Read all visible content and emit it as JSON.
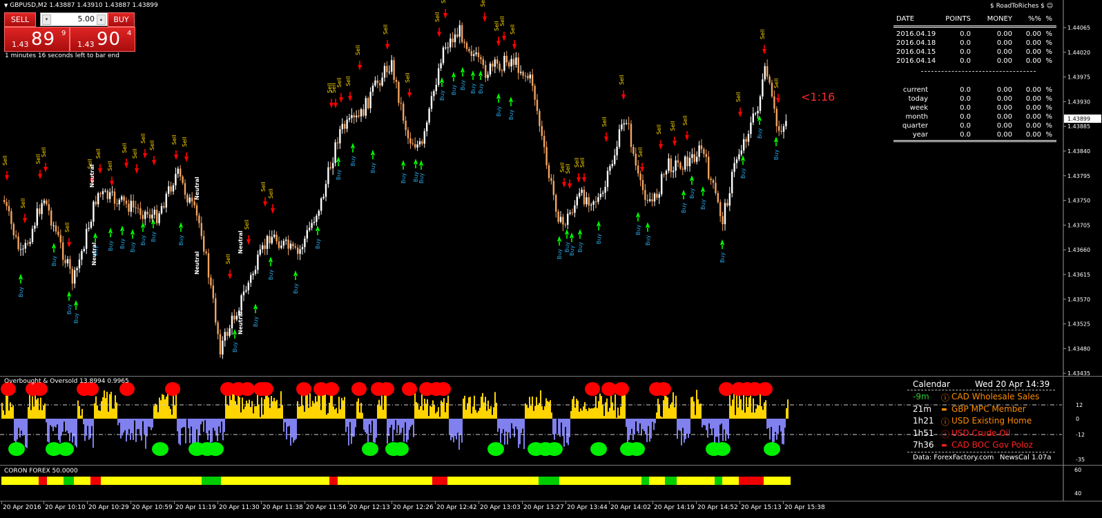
{
  "header": {
    "symbol": "GBPUSD,M2",
    "ohlc": "1.43887 1.43910 1.43887 1.43899",
    "ea_name": "$ RoadToRiches $ ☺",
    "countdown": "1 minutes 16 seconds left to bar end",
    "bar_timer": "<1:16"
  },
  "trade_panel": {
    "sell_label": "SELL",
    "buy_label": "BUY",
    "lot": "5.00",
    "sell_small": "1.43",
    "sell_big": "89",
    "sell_sup": "9",
    "buy_small": "1.43",
    "buy_big": "90",
    "buy_sup": "4"
  },
  "stats": {
    "columns": [
      "DATE",
      "POINTS",
      "MONEY",
      "%%",
      "%"
    ],
    "daily": [
      {
        "date": "2016.04.19",
        "points": "0.0",
        "money": "0.00",
        "pct": "0.00",
        "sign": "%"
      },
      {
        "date": "2016.04.18",
        "points": "0.0",
        "money": "0.00",
        "pct": "0.00",
        "sign": "%"
      },
      {
        "date": "2016.04.15",
        "points": "0.0",
        "money": "0.00",
        "pct": "0.00",
        "sign": "%"
      },
      {
        "date": "2016.04.14",
        "points": "0.0",
        "money": "0.00",
        "pct": "0.00",
        "sign": "%"
      }
    ],
    "periods": [
      {
        "label": "current",
        "points": "0.0",
        "money": "0.00",
        "pct": "0.00",
        "sign": "%"
      },
      {
        "label": "today",
        "points": "0.0",
        "money": "0.00",
        "pct": "0.00",
        "sign": "%"
      },
      {
        "label": "week",
        "points": "0.0",
        "money": "0.00",
        "pct": "0.00",
        "sign": "%"
      },
      {
        "label": "month",
        "points": "0.0",
        "money": "0.00",
        "pct": "0.00",
        "sign": "%"
      },
      {
        "label": "quarter",
        "points": "0.0",
        "money": "0.00",
        "pct": "0.00",
        "sign": "%"
      },
      {
        "label": "year",
        "points": "0.0",
        "money": "0.00",
        "pct": "0.00",
        "sign": "%"
      }
    ]
  },
  "price_axis": {
    "labels": [
      "1.44065",
      "1.44020",
      "1.43975",
      "1.43930",
      "1.43885",
      "1.43840",
      "1.43795",
      "1.43750",
      "1.43705",
      "1.43660",
      "1.43615",
      "1.43570",
      "1.43525",
      "1.43480",
      "1.43435"
    ],
    "current": "1.43899",
    "min": 1.43435,
    "max": 1.44065
  },
  "time_axis": [
    "20 Apr 2016",
    "20 Apr 10:10",
    "20 Apr 10:29",
    "20 Apr 10:59",
    "20 Apr 11:19",
    "20 Apr 11:30",
    "20 Apr 11:38",
    "20 Apr 11:56",
    "20 Apr 12:13",
    "20 Apr 12:26",
    "20 Apr 12:42",
    "20 Apr 13:03",
    "20 Apr 13:27",
    "20 Apr 13:44",
    "20 Apr 14:02",
    "20 Apr 14:19",
    "20 Apr 14:52",
    "20 Apr 15:13",
    "20 Apr 15:38"
  ],
  "signals": {
    "sell_label": "Sell",
    "buy_label": "Buy",
    "neutral_label": "Neutral"
  },
  "oscillator": {
    "title": "Overbought & Oversold 13.8994 0.9965",
    "levels": [
      "12",
      "0",
      "-12",
      "-35"
    ],
    "max": 35,
    "min": -35
  },
  "calendar": {
    "title": "Calendar",
    "datetime": "Wed 20 Apr 14:39",
    "events": [
      {
        "time": "-9m",
        "text": "CAD Wholesale Sales",
        "time_color": "#2ecc2e",
        "icon": "info-icon"
      },
      {
        "time": "21m",
        "text": "GBP MPC Member",
        "time_color": "#ffffff",
        "icon": "speech-icon"
      },
      {
        "time": "1h21",
        "text": "USD Existing Home",
        "time_color": "#ffffff",
        "icon": "info-icon"
      },
      {
        "time": "1h51",
        "text": "USD Crude Oil",
        "time_color": "#ffffff",
        "icon": "info-icon"
      },
      {
        "time": "7h36",
        "text": "CAD BOC Gov Poloz",
        "time_color": "#ffffff",
        "icon": "speech-icon"
      }
    ],
    "footer_left": "Data: ForexFactory.com",
    "footer_right": "NewsCal 1.07a"
  },
  "coron": {
    "title": "CORON FOREX 50.0000",
    "levels": [
      "60",
      "40"
    ]
  },
  "colors": {
    "bull_candle": "#ffffff",
    "bear_candle": "#f4a460",
    "sell_arrow": "#ff0000",
    "buy_arrow": "#00ff00",
    "sell_text": "#ffd700",
    "buy_text": "#29a3e0",
    "osc_pos": "#ffd400",
    "osc_neg": "#8080ee",
    "dot_red": "#ff0000",
    "dot_green": "#00ee00",
    "coron_yellow": "#ffff00",
    "coron_green": "#00cc00",
    "coron_red": "#ee0000",
    "event_orange": "#ff8c00",
    "event_red": "#ff2020"
  }
}
